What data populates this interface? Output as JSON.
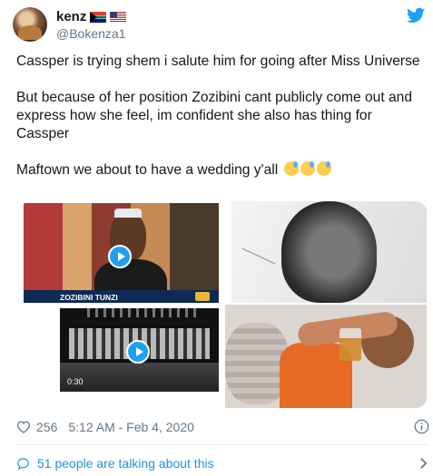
{
  "user": {
    "display_name": "kenz",
    "handle": "@Bokenza1",
    "flags": [
      "south-africa-flag",
      "us-flag"
    ]
  },
  "tweet": {
    "paragraphs": [
      "Cassper is trying shem i salute him for going after Miss Universe",
      "But because of her position Zozibini cant publicly come out and express how she feel, im confident she also has thing for Cassper",
      "Maftown we about to have a wedding y'all"
    ],
    "trailing_emojis": [
      "sweat-smile-emoji",
      "sweat-smile-emoji",
      "sweat-smile-emoji"
    ]
  },
  "media": {
    "tile_1_caption": "ZOZIBINI TUNZI",
    "tile_3_duration": "0:30"
  },
  "footer": {
    "likes": "256",
    "timestamp": "5:12 AM - Feb 4, 2020",
    "talking": "51 people are talking about this"
  },
  "colors": {
    "accent": "#1da1f2",
    "link": "#1b95e0",
    "muted": "#657786"
  }
}
